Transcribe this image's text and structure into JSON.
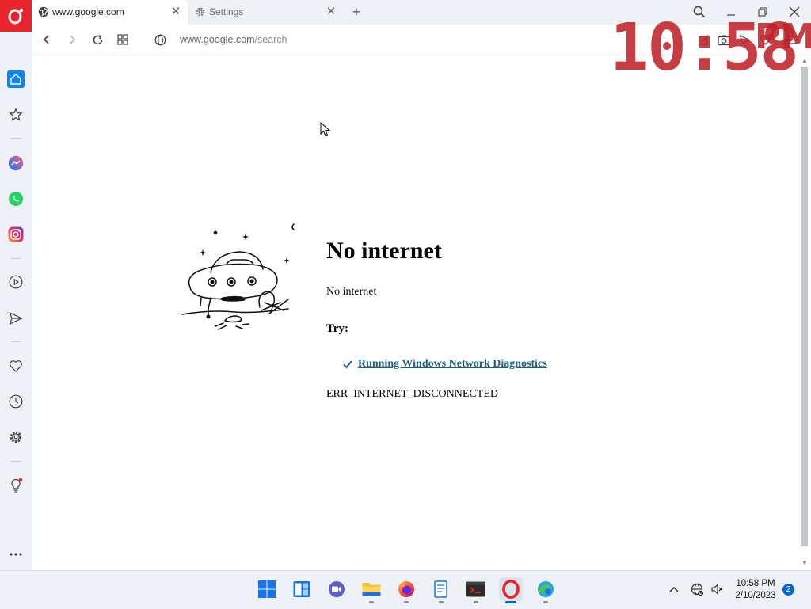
{
  "browser": {
    "tabs": [
      {
        "label": "www.google.com",
        "icon": "globe-icon",
        "active": true
      },
      {
        "label": "Settings",
        "icon": "gear-icon",
        "active": false
      }
    ],
    "new_tab": "+",
    "address": {
      "host": "www.google.com",
      "path": "/search"
    }
  },
  "clock_overlay": {
    "digits": "10:58",
    "ampm": "PM"
  },
  "sidebar": {
    "items": [
      {
        "name": "home",
        "icon": "home-icon"
      },
      {
        "name": "speed-dial",
        "icon": "star-icon"
      },
      {
        "name": "messenger",
        "icon": "messenger-icon"
      },
      {
        "name": "whatsapp",
        "icon": "whatsapp-icon"
      },
      {
        "name": "instagram",
        "icon": "instagram-icon"
      },
      {
        "name": "player",
        "icon": "play-icon"
      },
      {
        "name": "flow",
        "icon": "send-icon"
      },
      {
        "name": "bookmarks",
        "icon": "heart-icon"
      },
      {
        "name": "history",
        "icon": "clock-icon"
      },
      {
        "name": "settings",
        "icon": "gear-icon"
      },
      {
        "name": "tips",
        "icon": "lightbulb-icon"
      },
      {
        "name": "more",
        "icon": "more-icon"
      }
    ]
  },
  "error_page": {
    "title": "No internet",
    "subtitle": "No internet",
    "try_label": "Try:",
    "suggestion": "Running Windows Network Diagnostics",
    "code": "ERR_INTERNET_DISCONNECTED"
  },
  "taskbar": {
    "apps": [
      "start-icon",
      "widgets-icon",
      "chat-icon",
      "file-explorer-icon",
      "firefox-icon",
      "notepad-icon",
      "terminal-icon",
      "opera-icon",
      "edge-icon"
    ],
    "time": "10:58 PM",
    "date": "2/10/2023",
    "notifications": "2"
  },
  "colors": {
    "opera_red": "#e8252c",
    "sidebar_bg": "#eef1f6",
    "link": "#1a5f8a",
    "accent_blue": "#0a64c8"
  }
}
